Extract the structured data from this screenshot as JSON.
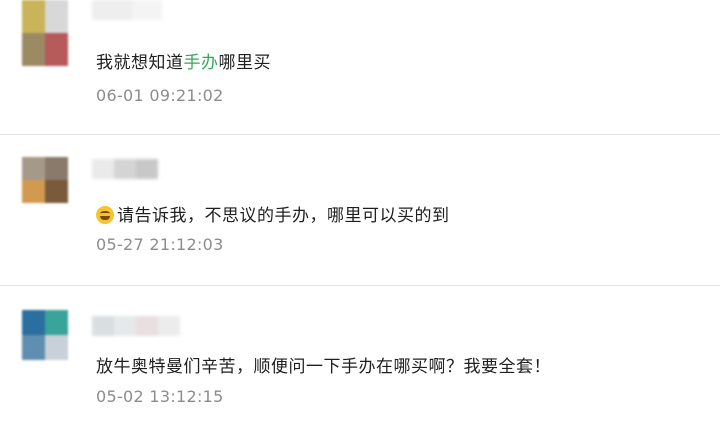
{
  "comments": [
    {
      "text_before": "我就想知道",
      "text_link": "手办",
      "text_after": "哪里买",
      "time": "06-01 09:21:02",
      "emoji": ""
    },
    {
      "text_before": "请告诉我，不思议的手办，哪里可以买的到",
      "text_link": "",
      "text_after": "",
      "time": "05-27 21:12:03",
      "emoji": "grinning-sweat-emoji"
    },
    {
      "text_before": "放牛奥特曼们辛苦，顺便问一下手办在哪买啊？我要全套！",
      "text_link": "",
      "text_after": "",
      "time": "05-02 13:12:15",
      "emoji": ""
    }
  ],
  "colors": {
    "link": "#3aa55d",
    "time": "#8c8c8c",
    "divider": "#e6e6e6"
  }
}
